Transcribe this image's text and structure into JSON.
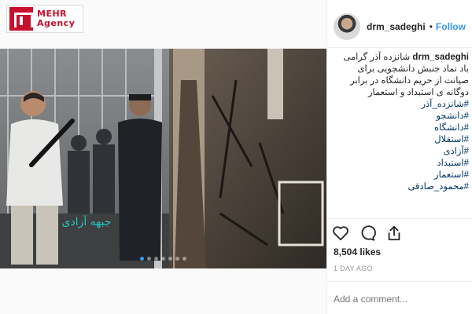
{
  "logo": {
    "line1": "MEHR",
    "line2": "Agency",
    "brand_color": "#c8102e"
  },
  "post": {
    "username": "drm_sadeghi",
    "separator": "•",
    "follow_label": "Follow",
    "caption_user": "drm_sadeghi",
    "caption_text": "شانزده آذر گرامی باد نماد جنبش دانشجویی برای صیانت از حریم دانشگاه در برابر دوگانه ی استبداد و استعمار",
    "hashtags": [
      "#شانزده_آذر",
      "#دانشجو",
      "#دانشگاه",
      "#استقلال",
      "#آزادی",
      "#استبداد",
      "#استعمار",
      "#محمود_صادقی"
    ],
    "likes": "8,504 likes",
    "time_ago": "1 DAY AGO",
    "comment_placeholder": "Add a comment...",
    "carousel": {
      "count": 7,
      "active_index": 0
    },
    "media_watermark": "جبهه آزادی",
    "accent_color": "#3897f0",
    "hashtag_color": "#003569"
  }
}
